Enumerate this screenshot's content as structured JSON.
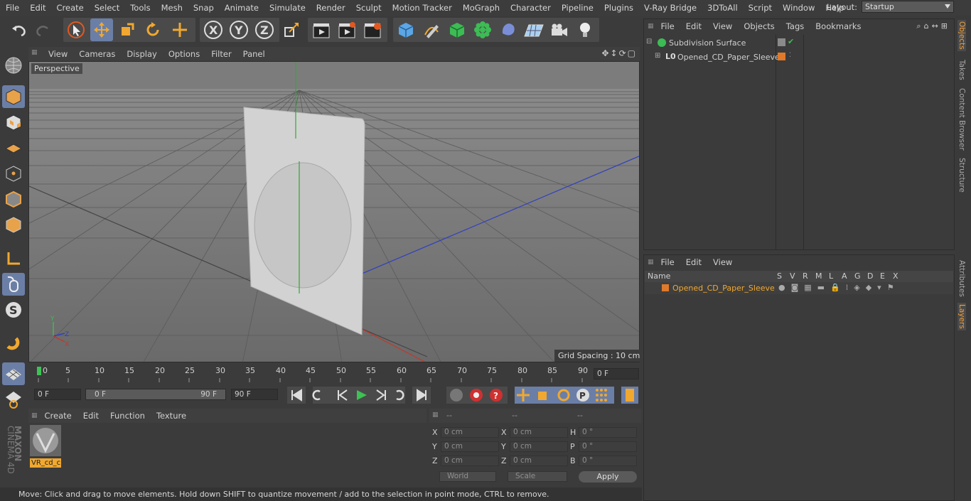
{
  "menu": [
    "File",
    "Edit",
    "Create",
    "Select",
    "Tools",
    "Mesh",
    "Snap",
    "Animate",
    "Simulate",
    "Render",
    "Sculpt",
    "Motion Tracker",
    "MoGraph",
    "Character",
    "Pipeline",
    "Plugins",
    "V-Ray Bridge",
    "3DToAll",
    "Script",
    "Window",
    "Help"
  ],
  "layout": {
    "label": "Layout:",
    "value": "Startup"
  },
  "viewport": {
    "menu": [
      "View",
      "Cameras",
      "Display",
      "Options",
      "Filter",
      "Panel"
    ],
    "camera_label": "Perspective",
    "grid_spacing": "Grid Spacing : 10 cm"
  },
  "timeline": {
    "ticks": [
      "0",
      "5",
      "10",
      "15",
      "20",
      "25",
      "30",
      "35",
      "40",
      "45",
      "50",
      "55",
      "60",
      "65",
      "70",
      "75",
      "80",
      "85",
      "90"
    ],
    "current_frame": "0 F",
    "start_field": "0 F",
    "range_start": "0 F",
    "range_end": "90 F",
    "end_field": "90 F"
  },
  "material_manager": {
    "menu": [
      "Create",
      "Edit",
      "Function",
      "Texture"
    ],
    "materials": [
      {
        "name": "VR_cd_c"
      }
    ]
  },
  "coordinates": {
    "headers": [
      "--",
      "--",
      "--"
    ],
    "rows": [
      {
        "l1": "X",
        "v1": "0 cm",
        "l2": "X",
        "v2": "0 cm",
        "l3": "H",
        "v3": "0 °"
      },
      {
        "l1": "Y",
        "v1": "0 cm",
        "l2": "Y",
        "v2": "0 cm",
        "l3": "P",
        "v3": "0 °"
      },
      {
        "l1": "Z",
        "v1": "0 cm",
        "l2": "Z",
        "v2": "0 cm",
        "l3": "B",
        "v3": "0 °"
      }
    ],
    "space": "World",
    "mode": "Scale",
    "apply": "Apply"
  },
  "status": "Move: Click and drag to move elements. Hold down SHIFT to quantize movement / add to the selection in point mode, CTRL to remove.",
  "object_manager": {
    "menu": [
      "File",
      "Edit",
      "View",
      "Objects",
      "Tags",
      "Bookmarks"
    ],
    "objects": [
      {
        "name": "Subdivision Surface"
      },
      {
        "name": "Opened_CD_Paper_Sleeve"
      }
    ]
  },
  "layer_manager": {
    "menu": [
      "File",
      "Edit",
      "View"
    ],
    "columns": [
      "Name",
      "S",
      "V",
      "R",
      "M",
      "L",
      "A",
      "G",
      "D",
      "E",
      "X"
    ],
    "layers": [
      {
        "name": "Opened_CD_Paper_Sleeve",
        "color": "#e07a2a"
      }
    ]
  },
  "right_tabs": [
    "Objects",
    "Takes",
    "Content Browser",
    "Structure",
    "Attributes",
    "Layers"
  ],
  "brand": {
    "line1": "MAXON",
    "line2": "CINEMA 4D"
  }
}
